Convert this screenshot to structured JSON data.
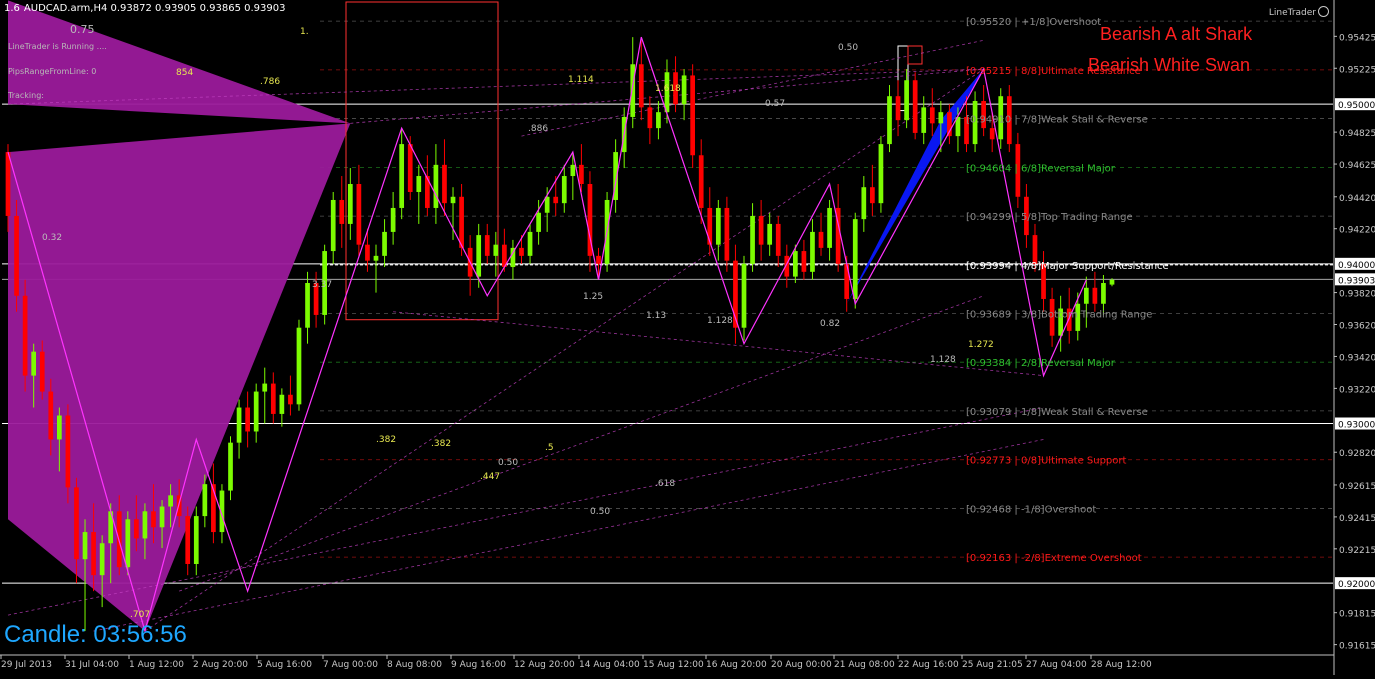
{
  "header": {
    "period_value": "1.6",
    "symbol_line": "AUDCAD.arm,H4  0.93872 0.93905 0.93865 0.93903"
  },
  "indicator_info": [
    "LineTrader is Running ....",
    "PipsRangeFromLine: 0",
    "Tracking:"
  ],
  "brand": "LineTrader",
  "patterns": [
    "Bearish A alt Shark",
    "Bearish White Swan"
  ],
  "candle_timer": {
    "label": "Candle:",
    "value": "03:56:56"
  },
  "colors": {
    "background": "#000000",
    "bull": "#7cfc00",
    "bear": "#ff0000",
    "pattern_fill": "#9b1a9b",
    "pattern_fill_2": "#0a18ff",
    "zigzag": "#ff33ff",
    "pattern_text": "#ff2020",
    "timer": "#1ea7ff"
  },
  "chart_data": {
    "type": "candlestick",
    "symbol": "AUDCAD.arm",
    "timeframe": "H4",
    "ylim": [
      0.9155,
      0.9564
    ],
    "y_ticks": [
      "0.95425",
      "0.95225",
      "0.95000",
      "0.94825",
      "0.94625",
      "0.94420",
      "0.94220",
      "0.94000",
      "0.93903",
      "0.93820",
      "0.93620",
      "0.93420",
      "0.93220",
      "0.93000",
      "0.92820",
      "0.92615",
      "0.92415",
      "0.92215",
      "0.92000",
      "0.91815",
      "0.91615"
    ],
    "current_price": "0.93903",
    "x_ticks": [
      "29 Jul 2013",
      "31 Jul 04:00",
      "1 Aug 12:00",
      "2 Aug 20:00",
      "5 Aug 16:00",
      "7 Aug 00:00",
      "8 Aug 08:00",
      "9 Aug 16:00",
      "12 Aug 20:00",
      "14 Aug 04:00",
      "15 Aug 12:00",
      "16 Aug 20:00",
      "20 Aug 00:00",
      "21 Aug 08:00",
      "22 Aug 16:00",
      "25 Aug 21:05",
      "27 Aug 04:00",
      "28 Aug 12:00"
    ],
    "horizontal_lines": [
      {
        "price": 0.95,
        "label": "0.95000"
      },
      {
        "price": 0.94,
        "label": "0.94000"
      },
      {
        "price": 0.93,
        "label": "0.93000"
      },
      {
        "price": 0.92,
        "label": "0.92000"
      }
    ],
    "murrey_levels": [
      {
        "label": "[0.95520 | +1/8]Overshoot",
        "price": 0.9552,
        "color": "#8a8a8a"
      },
      {
        "label": "[0.95215 | 8/8]Ultimate Resistance",
        "price": 0.95215,
        "color": "#ff1a1a"
      },
      {
        "label": "[0.94910 | 7/8]Weak Stall & Reverse",
        "price": 0.9491,
        "color": "#8a8a8a"
      },
      {
        "label": "[0.94604 | 6/8]Reversal Major",
        "price": 0.94604,
        "color": "#2fbf2f"
      },
      {
        "label": "[0.94299 | 5/8]Top Trading Range",
        "price": 0.94299,
        "color": "#8a8a8a"
      },
      {
        "label": "[0.93994 | 4/8]Major Support/Resistance",
        "price": 0.93994,
        "color": "#ffffff"
      },
      {
        "label": "[0.93689 | 3/8]Bottom Trading Range",
        "price": 0.93689,
        "color": "#8a8a8a"
      },
      {
        "label": "[0.93384 | 2/8]Reversal Major",
        "price": 0.93384,
        "color": "#2fbf2f"
      },
      {
        "label": "[0.93079 | 1/8]Weak Stall & Reverse",
        "price": 0.93079,
        "color": "#8a8a8a"
      },
      {
        "label": "[0.92773 | 0/8]Ultimate Support",
        "price": 0.92773,
        "color": "#ff1a1a"
      },
      {
        "label": "[0.92468 | -1/8]Overshoot",
        "price": 0.92468,
        "color": "#8a8a8a"
      },
      {
        "label": "[0.92163 | -2/8]Extreme Overshoot",
        "price": 0.92163,
        "color": "#ff1a1a"
      }
    ],
    "candles": [
      {
        "o": 0.947,
        "h": 0.9475,
        "l": 0.942,
        "c": 0.943
      },
      {
        "o": 0.943,
        "h": 0.944,
        "l": 0.937,
        "c": 0.938
      },
      {
        "o": 0.938,
        "h": 0.939,
        "l": 0.932,
        "c": 0.933
      },
      {
        "o": 0.933,
        "h": 0.935,
        "l": 0.931,
        "c": 0.9345
      },
      {
        "o": 0.9345,
        "h": 0.9352,
        "l": 0.9315,
        "c": 0.932
      },
      {
        "o": 0.932,
        "h": 0.9328,
        "l": 0.928,
        "c": 0.929
      },
      {
        "o": 0.929,
        "h": 0.931,
        "l": 0.927,
        "c": 0.9305
      },
      {
        "o": 0.9305,
        "h": 0.9312,
        "l": 0.925,
        "c": 0.926
      },
      {
        "o": 0.926,
        "h": 0.9266,
        "l": 0.92,
        "c": 0.9215
      },
      {
        "o": 0.9215,
        "h": 0.924,
        "l": 0.917,
        "c": 0.9232
      },
      {
        "o": 0.9232,
        "h": 0.925,
        "l": 0.9195,
        "c": 0.9205
      },
      {
        "o": 0.9205,
        "h": 0.923,
        "l": 0.9185,
        "c": 0.9225
      },
      {
        "o": 0.9225,
        "h": 0.925,
        "l": 0.92,
        "c": 0.9245
      },
      {
        "o": 0.9245,
        "h": 0.9255,
        "l": 0.9205,
        "c": 0.921
      },
      {
        "o": 0.921,
        "h": 0.9245,
        "l": 0.9205,
        "c": 0.924
      },
      {
        "o": 0.924,
        "h": 0.9255,
        "l": 0.922,
        "c": 0.9228
      },
      {
        "o": 0.9228,
        "h": 0.925,
        "l": 0.9215,
        "c": 0.9245
      },
      {
        "o": 0.9245,
        "h": 0.9262,
        "l": 0.9225,
        "c": 0.9235
      },
      {
        "o": 0.9235,
        "h": 0.9252,
        "l": 0.9222,
        "c": 0.9248
      },
      {
        "o": 0.9248,
        "h": 0.9262,
        "l": 0.9235,
        "c": 0.9255
      },
      {
        "o": 0.9255,
        "h": 0.9265,
        "l": 0.9235,
        "c": 0.9242
      },
      {
        "o": 0.9242,
        "h": 0.9248,
        "l": 0.9205,
        "c": 0.9212
      },
      {
        "o": 0.9212,
        "h": 0.9248,
        "l": 0.9205,
        "c": 0.9242
      },
      {
        "o": 0.9242,
        "h": 0.9268,
        "l": 0.9235,
        "c": 0.9262
      },
      {
        "o": 0.9262,
        "h": 0.9275,
        "l": 0.9225,
        "c": 0.9232
      },
      {
        "o": 0.9232,
        "h": 0.9262,
        "l": 0.9225,
        "c": 0.9258
      },
      {
        "o": 0.9258,
        "h": 0.9292,
        "l": 0.9252,
        "c": 0.9288
      },
      {
        "o": 0.9288,
        "h": 0.9315,
        "l": 0.9278,
        "c": 0.931
      },
      {
        "o": 0.931,
        "h": 0.932,
        "l": 0.9285,
        "c": 0.9295
      },
      {
        "o": 0.9295,
        "h": 0.9325,
        "l": 0.9288,
        "c": 0.932
      },
      {
        "o": 0.932,
        "h": 0.9335,
        "l": 0.93,
        "c": 0.9325
      },
      {
        "o": 0.9325,
        "h": 0.9332,
        "l": 0.93,
        "c": 0.9306
      },
      {
        "o": 0.9306,
        "h": 0.9322,
        "l": 0.9298,
        "c": 0.9318
      },
      {
        "o": 0.9318,
        "h": 0.933,
        "l": 0.9305,
        "c": 0.9312
      },
      {
        "o": 0.9312,
        "h": 0.9365,
        "l": 0.9308,
        "c": 0.936
      },
      {
        "o": 0.936,
        "h": 0.9395,
        "l": 0.935,
        "c": 0.9388
      },
      {
        "o": 0.9388,
        "h": 0.9395,
        "l": 0.936,
        "c": 0.9368
      },
      {
        "o": 0.9368,
        "h": 0.9412,
        "l": 0.9362,
        "c": 0.9408
      },
      {
        "o": 0.9408,
        "h": 0.9445,
        "l": 0.94,
        "c": 0.944
      },
      {
        "o": 0.944,
        "h": 0.9455,
        "l": 0.941,
        "c": 0.9425
      },
      {
        "o": 0.9425,
        "h": 0.946,
        "l": 0.9415,
        "c": 0.945
      },
      {
        "o": 0.945,
        "h": 0.9462,
        "l": 0.9405,
        "c": 0.9412
      },
      {
        "o": 0.9412,
        "h": 0.9422,
        "l": 0.9395,
        "c": 0.9402
      },
      {
        "o": 0.9402,
        "h": 0.9412,
        "l": 0.9382,
        "c": 0.9405
      },
      {
        "o": 0.9405,
        "h": 0.9428,
        "l": 0.9398,
        "c": 0.942
      },
      {
        "o": 0.942,
        "h": 0.9445,
        "l": 0.9412,
        "c": 0.9435
      },
      {
        "o": 0.9435,
        "h": 0.9485,
        "l": 0.9428,
        "c": 0.9475
      },
      {
        "o": 0.9475,
        "h": 0.948,
        "l": 0.944,
        "c": 0.9445
      },
      {
        "o": 0.9445,
        "h": 0.9462,
        "l": 0.9425,
        "c": 0.9455
      },
      {
        "o": 0.9455,
        "h": 0.9468,
        "l": 0.943,
        "c": 0.9435
      },
      {
        "o": 0.9435,
        "h": 0.9475,
        "l": 0.9425,
        "c": 0.9462
      },
      {
        "o": 0.9462,
        "h": 0.9478,
        "l": 0.943,
        "c": 0.9438
      },
      {
        "o": 0.9438,
        "h": 0.9448,
        "l": 0.9415,
        "c": 0.9442
      },
      {
        "o": 0.9442,
        "h": 0.945,
        "l": 0.9405,
        "c": 0.941
      },
      {
        "o": 0.941,
        "h": 0.9418,
        "l": 0.938,
        "c": 0.9392
      },
      {
        "o": 0.9392,
        "h": 0.9425,
        "l": 0.9385,
        "c": 0.9418
      },
      {
        "o": 0.9418,
        "h": 0.9425,
        "l": 0.94,
        "c": 0.9405
      },
      {
        "o": 0.9405,
        "h": 0.942,
        "l": 0.9392,
        "c": 0.9412
      },
      {
        "o": 0.9412,
        "h": 0.9422,
        "l": 0.9395,
        "c": 0.9398
      },
      {
        "o": 0.9398,
        "h": 0.9415,
        "l": 0.939,
        "c": 0.941
      },
      {
        "o": 0.941,
        "h": 0.9418,
        "l": 0.94,
        "c": 0.9405
      },
      {
        "o": 0.9405,
        "h": 0.9425,
        "l": 0.94,
        "c": 0.942
      },
      {
        "o": 0.942,
        "h": 0.944,
        "l": 0.9412,
        "c": 0.9432
      },
      {
        "o": 0.9432,
        "h": 0.9448,
        "l": 0.942,
        "c": 0.9442
      },
      {
        "o": 0.9442,
        "h": 0.9455,
        "l": 0.943,
        "c": 0.9438
      },
      {
        "o": 0.9438,
        "h": 0.9462,
        "l": 0.9432,
        "c": 0.9455
      },
      {
        "o": 0.9455,
        "h": 0.947,
        "l": 0.944,
        "c": 0.9462
      },
      {
        "o": 0.9462,
        "h": 0.9475,
        "l": 0.9445,
        "c": 0.945
      },
      {
        "o": 0.945,
        "h": 0.9458,
        "l": 0.9395,
        "c": 0.9405
      },
      {
        "o": 0.9405,
        "h": 0.941,
        "l": 0.939,
        "c": 0.94
      },
      {
        "o": 0.94,
        "h": 0.9445,
        "l": 0.9395,
        "c": 0.944
      },
      {
        "o": 0.944,
        "h": 0.9478,
        "l": 0.9432,
        "c": 0.947
      },
      {
        "o": 0.947,
        "h": 0.9498,
        "l": 0.946,
        "c": 0.9492
      },
      {
        "o": 0.9492,
        "h": 0.9542,
        "l": 0.9485,
        "c": 0.9525
      },
      {
        "o": 0.9525,
        "h": 0.954,
        "l": 0.949,
        "c": 0.9498
      },
      {
        "o": 0.9498,
        "h": 0.9505,
        "l": 0.9475,
        "c": 0.9485
      },
      {
        "o": 0.9485,
        "h": 0.9502,
        "l": 0.9478,
        "c": 0.9495
      },
      {
        "o": 0.9495,
        "h": 0.9528,
        "l": 0.9488,
        "c": 0.952
      },
      {
        "o": 0.952,
        "h": 0.953,
        "l": 0.9495,
        "c": 0.95
      },
      {
        "o": 0.95,
        "h": 0.9522,
        "l": 0.949,
        "c": 0.9518
      },
      {
        "o": 0.9518,
        "h": 0.9525,
        "l": 0.946,
        "c": 0.9468
      },
      {
        "o": 0.9468,
        "h": 0.9478,
        "l": 0.9425,
        "c": 0.9435
      },
      {
        "o": 0.9435,
        "h": 0.9448,
        "l": 0.9405,
        "c": 0.9412
      },
      {
        "o": 0.9412,
        "h": 0.944,
        "l": 0.9402,
        "c": 0.9435
      },
      {
        "o": 0.9435,
        "h": 0.9442,
        "l": 0.9395,
        "c": 0.9402
      },
      {
        "o": 0.9402,
        "h": 0.9412,
        "l": 0.935,
        "c": 0.936
      },
      {
        "o": 0.936,
        "h": 0.9405,
        "l": 0.9352,
        "c": 0.94
      },
      {
        "o": 0.94,
        "h": 0.9438,
        "l": 0.9395,
        "c": 0.943
      },
      {
        "o": 0.943,
        "h": 0.944,
        "l": 0.9402,
        "c": 0.9412
      },
      {
        "o": 0.9412,
        "h": 0.9432,
        "l": 0.9405,
        "c": 0.9425
      },
      {
        "o": 0.9425,
        "h": 0.943,
        "l": 0.9398,
        "c": 0.9405
      },
      {
        "o": 0.9405,
        "h": 0.9412,
        "l": 0.9385,
        "c": 0.9392
      },
      {
        "o": 0.9392,
        "h": 0.9412,
        "l": 0.9388,
        "c": 0.9408
      },
      {
        "o": 0.9408,
        "h": 0.9415,
        "l": 0.939,
        "c": 0.9395
      },
      {
        "o": 0.9395,
        "h": 0.9428,
        "l": 0.939,
        "c": 0.942
      },
      {
        "o": 0.942,
        "h": 0.9432,
        "l": 0.9405,
        "c": 0.941
      },
      {
        "o": 0.941,
        "h": 0.944,
        "l": 0.9402,
        "c": 0.9435
      },
      {
        "o": 0.9435,
        "h": 0.945,
        "l": 0.9395,
        "c": 0.94
      },
      {
        "o": 0.94,
        "h": 0.9405,
        "l": 0.937,
        "c": 0.9378
      },
      {
        "o": 0.9378,
        "h": 0.9432,
        "l": 0.9372,
        "c": 0.9428
      },
      {
        "o": 0.9428,
        "h": 0.9455,
        "l": 0.942,
        "c": 0.9448
      },
      {
        "o": 0.9448,
        "h": 0.9462,
        "l": 0.943,
        "c": 0.9438
      },
      {
        "o": 0.9438,
        "h": 0.948,
        "l": 0.9432,
        "c": 0.9475
      },
      {
        "o": 0.9475,
        "h": 0.9512,
        "l": 0.947,
        "c": 0.9505
      },
      {
        "o": 0.9505,
        "h": 0.9515,
        "l": 0.948,
        "c": 0.949
      },
      {
        "o": 0.949,
        "h": 0.9522,
        "l": 0.9485,
        "c": 0.9515
      },
      {
        "o": 0.9515,
        "h": 0.952,
        "l": 0.9478,
        "c": 0.9482
      },
      {
        "o": 0.9482,
        "h": 0.9505,
        "l": 0.9475,
        "c": 0.9498
      },
      {
        "o": 0.9498,
        "h": 0.951,
        "l": 0.948,
        "c": 0.9488
      },
      {
        "o": 0.9488,
        "h": 0.9502,
        "l": 0.947,
        "c": 0.9495
      },
      {
        "o": 0.9495,
        "h": 0.95,
        "l": 0.9475,
        "c": 0.948
      },
      {
        "o": 0.948,
        "h": 0.9498,
        "l": 0.947,
        "c": 0.9492
      },
      {
        "o": 0.9492,
        "h": 0.9505,
        "l": 0.947,
        "c": 0.9475
      },
      {
        "o": 0.9475,
        "h": 0.9508,
        "l": 0.947,
        "c": 0.9502
      },
      {
        "o": 0.9502,
        "h": 0.9512,
        "l": 0.948,
        "c": 0.9485
      },
      {
        "o": 0.9485,
        "h": 0.9495,
        "l": 0.947,
        "c": 0.9478
      },
      {
        "o": 0.9478,
        "h": 0.951,
        "l": 0.9472,
        "c": 0.9505
      },
      {
        "o": 0.9505,
        "h": 0.9512,
        "l": 0.947,
        "c": 0.9475
      },
      {
        "o": 0.9475,
        "h": 0.9482,
        "l": 0.9435,
        "c": 0.9442
      },
      {
        "o": 0.9442,
        "h": 0.945,
        "l": 0.941,
        "c": 0.9418
      },
      {
        "o": 0.9418,
        "h": 0.9425,
        "l": 0.9395,
        "c": 0.94
      },
      {
        "o": 0.94,
        "h": 0.9408,
        "l": 0.937,
        "c": 0.9378
      },
      {
        "o": 0.9378,
        "h": 0.9385,
        "l": 0.9348,
        "c": 0.9355
      },
      {
        "o": 0.9355,
        "h": 0.938,
        "l": 0.9345,
        "c": 0.9372
      },
      {
        "o": 0.9372,
        "h": 0.9385,
        "l": 0.935,
        "c": 0.9358
      },
      {
        "o": 0.9358,
        "h": 0.9382,
        "l": 0.9352,
        "c": 0.9375
      },
      {
        "o": 0.9375,
        "h": 0.9392,
        "l": 0.936,
        "c": 0.9385
      },
      {
        "o": 0.9385,
        "h": 0.9395,
        "l": 0.937,
        "c": 0.9375
      },
      {
        "o": 0.9375,
        "h": 0.9393,
        "l": 0.9368,
        "c": 0.9388
      },
      {
        "o": 0.9387,
        "h": 0.9391,
        "l": 0.9386,
        "c": 0.939
      }
    ],
    "fib_labels": [
      "0.75",
      "1.",
      "854",
      ".786",
      "0.32",
      "3.37",
      "1.114",
      "1.618",
      ".886",
      "0.57",
      "0.50",
      "1.25",
      "1.13",
      "1.128",
      "0.82",
      "1.272",
      "1.128",
      ".382",
      ".382",
      "0.50",
      ".5",
      ".447",
      ".618",
      "0.50",
      ".707"
    ]
  }
}
